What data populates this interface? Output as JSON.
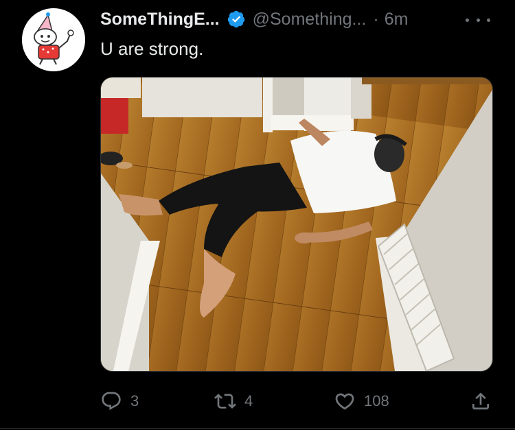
{
  "tweet": {
    "display_name": "SomeThingE...",
    "handle": "@Something...",
    "separator": "·",
    "time": "6m",
    "text": "U are strong.",
    "avatar_icon": "cartoon-party-hat-avatar",
    "verified_icon": "verified-badge-icon",
    "more_icon": "more-dots-icon",
    "media_description": "person-lying-on-wood-floor-photo"
  },
  "actions": {
    "reply": {
      "icon": "reply-icon",
      "count": "3"
    },
    "retweet": {
      "icon": "retweet-icon",
      "count": "4"
    },
    "like": {
      "icon": "heart-icon",
      "count": "108"
    },
    "share": {
      "icon": "share-icon"
    }
  },
  "colors": {
    "background": "#000000",
    "text": "#e7e9ea",
    "muted": "#71767b",
    "verified": "#1d9bf0"
  }
}
